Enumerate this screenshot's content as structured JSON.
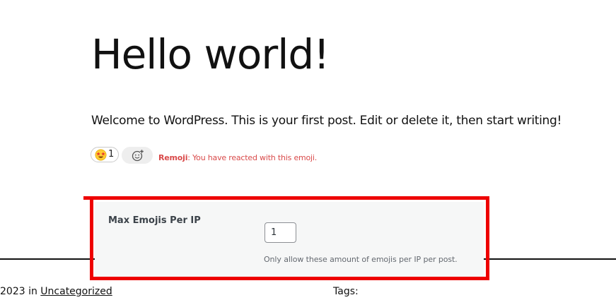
{
  "post": {
    "title": "Hello world!",
    "content": "Welcome to WordPress. This is your first post. Edit or delete it, then start writing!"
  },
  "reactions": {
    "emoji_icon": "star-struck-emoji",
    "count": "1",
    "add_icon": "add-emoji-icon",
    "notice_prefix": "Remoji",
    "notice_text": ": You have reacted with this emoji.",
    "notice_color": "#d94a4a"
  },
  "footer": {
    "date_text": "2023 in ",
    "category": "Uncategorized",
    "tags_label": "Tags:"
  },
  "settings": {
    "label": "Max Emojis Per IP",
    "value": "1",
    "help": "Only allow these amount of emojis per IP per post."
  },
  "highlight_color": "#ee0000"
}
